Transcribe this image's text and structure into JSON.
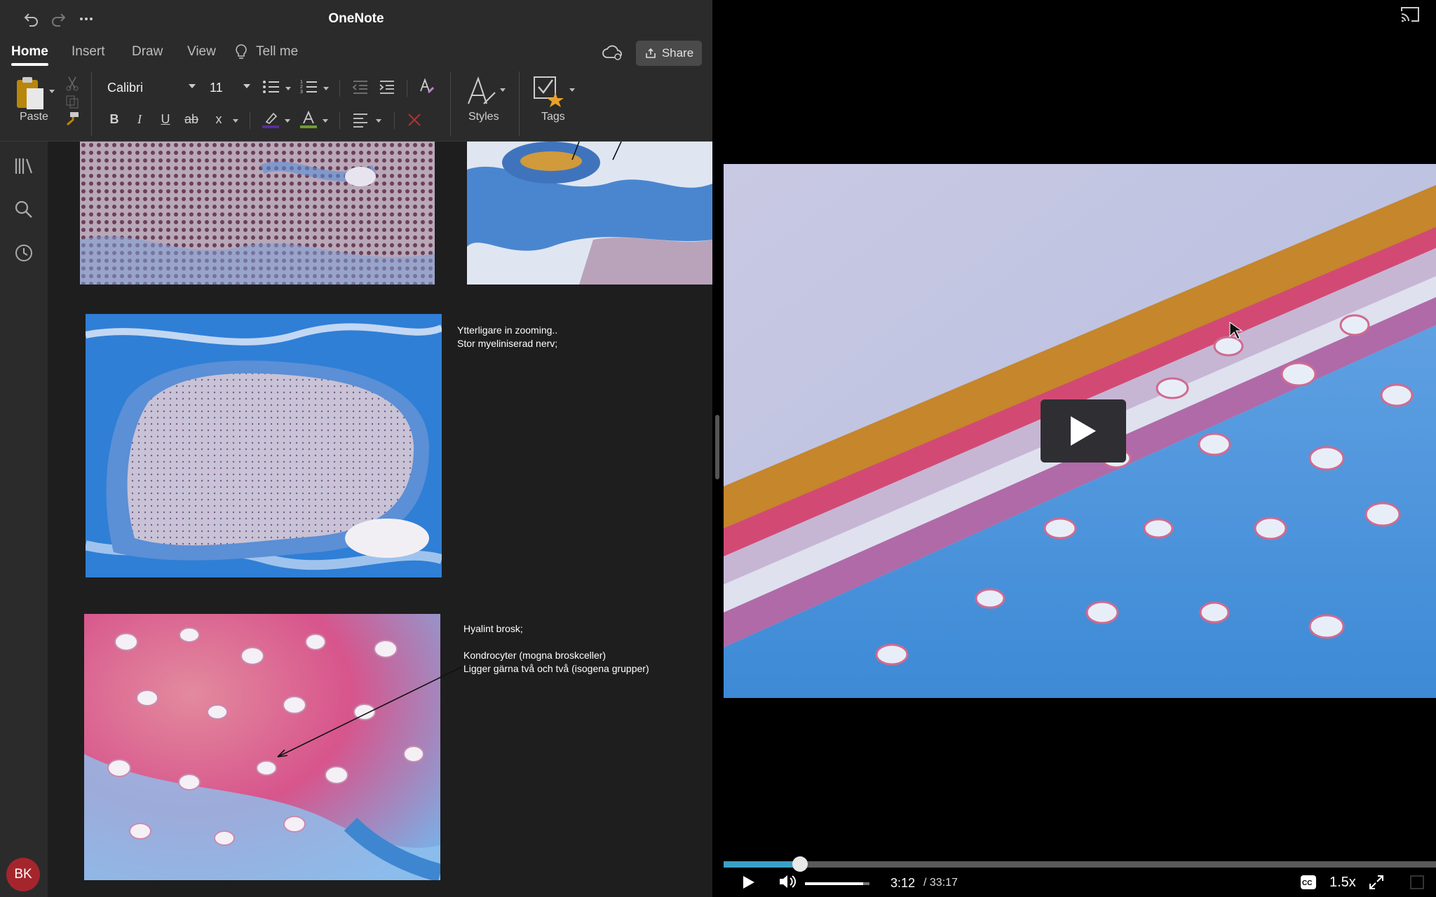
{
  "app": {
    "title": "OneNote"
  },
  "ribbon": {
    "tabs": [
      {
        "label": "Home",
        "active": true
      },
      {
        "label": "Insert"
      },
      {
        "label": "Draw"
      },
      {
        "label": "View"
      },
      {
        "label": "Tell me"
      }
    ],
    "share_label": "Share",
    "paste_label": "Paste",
    "font_name": "Calibri",
    "font_size": "11",
    "styles_label": "Styles",
    "tags_label": "Tags",
    "format_buttons": [
      "B",
      "I",
      "U",
      "ab",
      "x"
    ]
  },
  "user": {
    "initials": "BK"
  },
  "notes": {
    "nerve": {
      "line1": "Ytterligare in zooming..",
      "line2": "Stor myeliniserad nerv;"
    },
    "cartilage": {
      "line1": "Hyalint brosk;",
      "line2": "Kondrocyter (mogna broskceller)",
      "line3": "Ligger gärna två och två (isogena grupper)"
    }
  },
  "video": {
    "current_time": "3:12",
    "duration": "/ 33:17",
    "speed": "1.5x",
    "progress": 0.107,
    "volume": 0.9
  },
  "colors": {
    "accent_progress": "#3aa0c8",
    "avatar": "#a4262c",
    "stain_blue": "#3f86d1",
    "stain_pink": "#d7558c",
    "stain_orange": "#c5862c"
  }
}
